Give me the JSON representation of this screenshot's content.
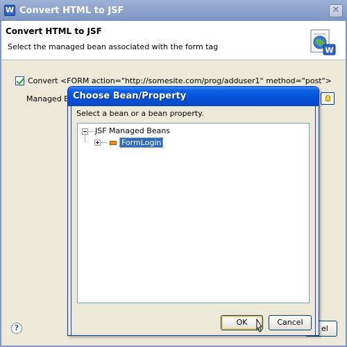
{
  "outer_window": {
    "title": "Convert HTML to JSF",
    "app_icon_letter": "W",
    "header_title": "Convert HTML to JSF",
    "header_description": "Select the managed bean associated with the form tag",
    "convert_checkbox_label": "Convert <FORM action=\"http://somesite.com/prog/adduser1\" method=\"post\">",
    "managed_bean_label": "Managed Be",
    "help_icon": "?",
    "cancel_partial_label": "el"
  },
  "inner_dialog": {
    "title": "Choose Bean/Property",
    "prompt": "Select a bean or a bean property.",
    "tree": {
      "root_label": "JSF Managed Beans",
      "children": [
        {
          "label": "FormLogin",
          "selected": true
        }
      ]
    },
    "ok_label": "OK",
    "cancel_label": "Cancel"
  },
  "colors": {
    "titlebar_active": "#0450d6",
    "selection": "#316ac5",
    "bean_icon": "#f08a1c"
  }
}
